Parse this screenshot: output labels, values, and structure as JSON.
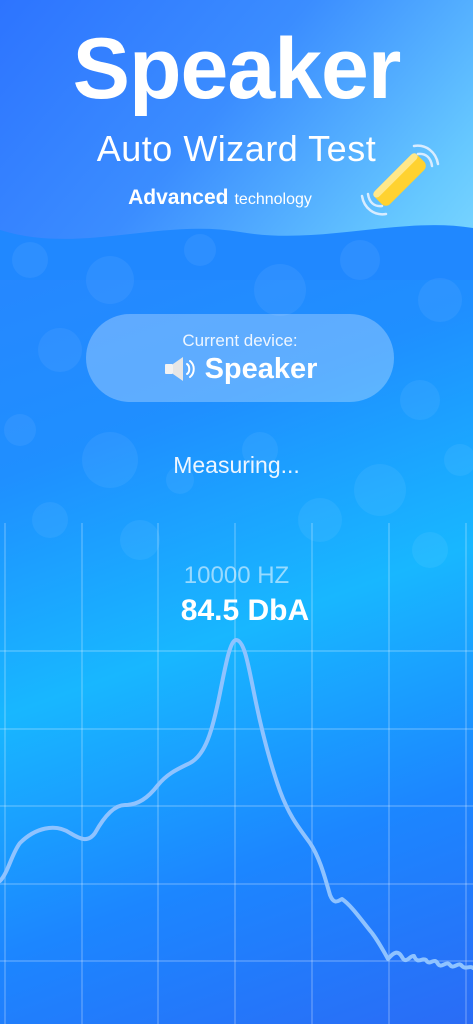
{
  "header": {
    "title": "Speaker",
    "subtitle": "Auto Wizard Test",
    "tagline_bold": "Advanced",
    "tagline_rest": "technology",
    "wand_icon": "magic-wand-icon"
  },
  "device": {
    "label": "Current device:",
    "name": "Speaker",
    "icon": "speaker-icon"
  },
  "status": "Measuring...",
  "measurement": {
    "frequency": "10000 HZ",
    "level": "84.5 DbA"
  },
  "colors": {
    "background": "#1f8fff",
    "pill": "rgba(255,255,255,0.28)",
    "curve": "#8fc3ff"
  }
}
